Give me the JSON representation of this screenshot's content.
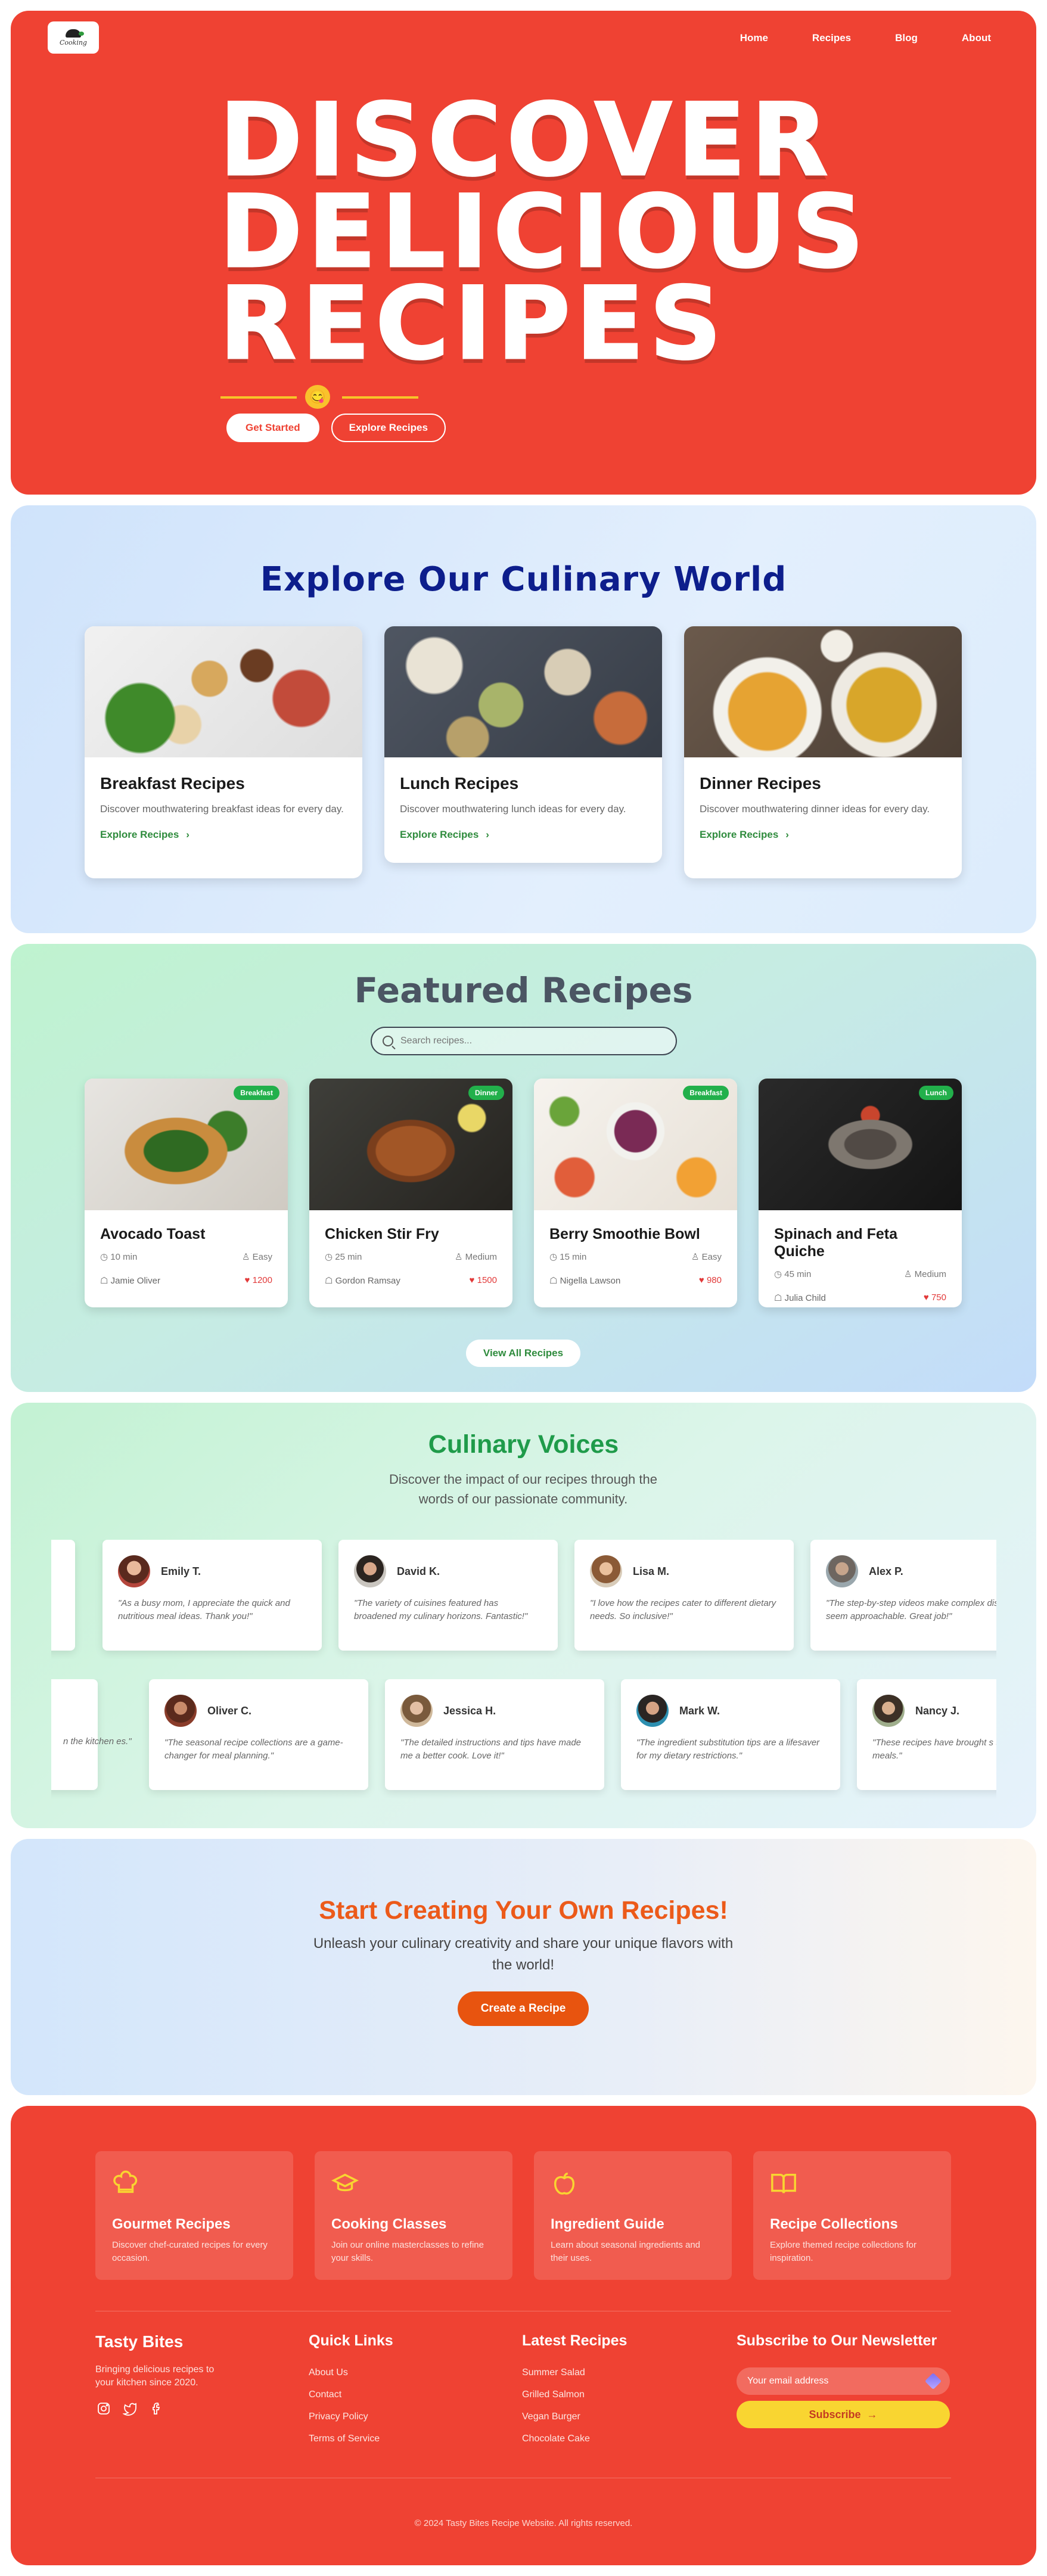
{
  "header": {
    "logo_text": "Cooking",
    "nav": [
      "Home",
      "Recipes",
      "Blog",
      "About"
    ]
  },
  "hero": {
    "title_lines": [
      "DISCOVER",
      "DELICIOUS",
      "RECIPES"
    ],
    "emoji": "😋",
    "primary_button": "Get Started",
    "secondary_button": "Explore Recipes"
  },
  "explore": {
    "title": "Explore Our Culinary World",
    "cards": [
      {
        "title": "Breakfast Recipes",
        "desc": "Discover mouthwatering breakfast ideas for every day.",
        "link": "Explore Recipes"
      },
      {
        "title": "Lunch Recipes",
        "desc": "Discover mouthwatering lunch ideas for every day.",
        "link": "Explore Recipes"
      },
      {
        "title": "Dinner Recipes",
        "desc": "Discover mouthwatering dinner ideas for every day.",
        "link": "Explore Recipes"
      }
    ]
  },
  "featured": {
    "title": "Featured Recipes",
    "search_placeholder": "Search recipes...",
    "recipes": [
      {
        "title": "Avocado Toast",
        "badge": "Breakfast",
        "time": "10 min",
        "difficulty": "Easy",
        "author": "Jamie Oliver",
        "likes": "1200"
      },
      {
        "title": "Chicken Stir Fry",
        "badge": "Dinner",
        "time": "25 min",
        "difficulty": "Medium",
        "author": "Gordon Ramsay",
        "likes": "1500"
      },
      {
        "title": "Berry Smoothie Bowl",
        "badge": "Breakfast",
        "time": "15 min",
        "difficulty": "Easy",
        "author": "Nigella Lawson",
        "likes": "980"
      },
      {
        "title": "Spinach and Feta Quiche",
        "badge": "Lunch",
        "time": "45 min",
        "difficulty": "Medium",
        "author": "Julia Child",
        "likes": "750"
      }
    ],
    "view_all": "View All Recipes"
  },
  "voices": {
    "title": "Culinary Voices",
    "subtitle": "Discover the impact of our recipes through the words of our passionate community.",
    "row1": [
      {
        "name": "Emily T.",
        "quote": "\"As a busy mom, I appreciate the quick and nutritious meal ideas. Thank you!\""
      },
      {
        "name": "David K.",
        "quote": "\"The variety of cuisines featured has broadened my culinary horizons. Fantastic!\""
      },
      {
        "name": "Lisa M.",
        "quote": "\"I love how the recipes cater to different dietary needs. So inclusive!\""
      },
      {
        "name": "Alex P.",
        "quote": "\"The step-by-step videos make complex dishes seem approachable. Great job!\""
      }
    ],
    "row2": [
      {
        "name": "",
        "quote": "n the kitchen es.\""
      },
      {
        "name": "Oliver C.",
        "quote": "\"The seasonal recipe collections are a game-changer for meal planning.\""
      },
      {
        "name": "Jessica H.",
        "quote": "\"The detailed instructions and tips have made me a better cook. Love it!\""
      },
      {
        "name": "Mark W.",
        "quote": "\"The ingredient substitution tips are a lifesaver for my dietary restrictions.\""
      },
      {
        "name": "Nancy J.",
        "quote": "\"These recipes have brought s to our family meals.\""
      }
    ]
  },
  "cta": {
    "title": "Start Creating Your Own Recipes!",
    "subtitle": "Unleash your culinary creativity and share your unique flavors with the world!",
    "button": "Create a Recipe"
  },
  "footer": {
    "features": [
      {
        "icon": "chef-hat-icon",
        "title": "Gourmet Recipes",
        "desc": "Discover chef-curated recipes for every occasion."
      },
      {
        "icon": "graduation-cap-icon",
        "title": "Cooking Classes",
        "desc": "Join our online masterclasses to refine your skills."
      },
      {
        "icon": "apple-icon",
        "title": "Ingredient Guide",
        "desc": "Learn about seasonal ingredients and their uses."
      },
      {
        "icon": "book-open-icon",
        "title": "Recipe Collections",
        "desc": "Explore themed recipe collections for inspiration."
      }
    ],
    "brand": {
      "name": "Tasty Bites",
      "desc": "Bringing delicious recipes to your kitchen since 2020."
    },
    "quick_links": {
      "title": "Quick Links",
      "items": [
        "About Us",
        "Contact",
        "Privacy Policy",
        "Terms of Service"
      ]
    },
    "latest": {
      "title": "Latest Recipes",
      "items": [
        "Summer Salad",
        "Grilled Salmon",
        "Vegan Burger",
        "Chocolate Cake"
      ]
    },
    "newsletter": {
      "title": "Subscribe to Our Newsletter",
      "placeholder": "Your email address",
      "button": "Subscribe"
    },
    "copyright": "© 2024 Tasty Bites Recipe Website. All rights reserved."
  },
  "colors": {
    "hero_red": "#ef4233",
    "accent_green": "#2e8b3c",
    "cta_orange": "#e8540f",
    "yellow": "#f9d531"
  }
}
